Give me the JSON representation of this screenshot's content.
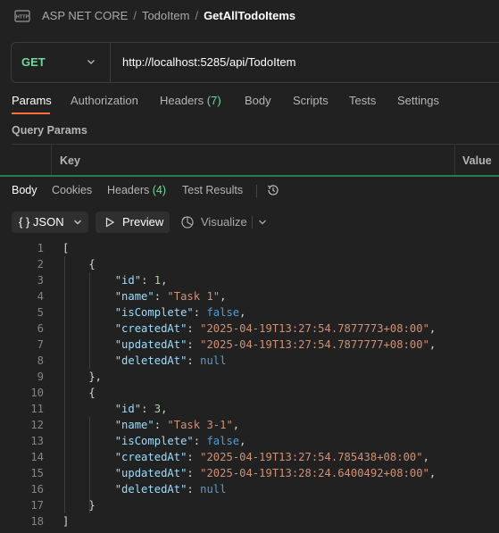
{
  "breadcrumb": {
    "icon": "http-request-icon",
    "items": [
      "ASP NET CORE",
      "TodoItem"
    ],
    "separator": "/",
    "current": "GetAllTodoItems"
  },
  "request": {
    "method": "GET",
    "url": "http://localhost:5285/api/TodoItem"
  },
  "request_tabs": {
    "params": "Params",
    "authorization": "Authorization",
    "headers": "Headers",
    "headers_count": "(7)",
    "body": "Body",
    "scripts": "Scripts",
    "tests": "Tests",
    "settings": "Settings"
  },
  "query_params": {
    "title": "Query Params",
    "key_header": "Key",
    "value_header": "Value"
  },
  "response_tabs": {
    "body": "Body",
    "cookies": "Cookies",
    "headers": "Headers",
    "headers_count": "(4)",
    "test_results": "Test Results"
  },
  "toolbar": {
    "format": "{ } JSON",
    "preview": "Preview",
    "visualize": "Visualize"
  },
  "colors": {
    "accent": "#ff6c37",
    "method": "#6bdd9a",
    "divider": "#247d4b"
  },
  "response_lines": [
    {
      "n": "1",
      "t": [
        [
          "p",
          "["
        ]
      ]
    },
    {
      "n": "2",
      "t": [
        [
          "p",
          "    {"
        ]
      ]
    },
    {
      "n": "3",
      "t": [
        [
          "p",
          "        "
        ],
        [
          "k",
          "\"id\""
        ],
        [
          "p",
          ": "
        ],
        [
          "n",
          "1"
        ],
        [
          "p",
          ","
        ]
      ]
    },
    {
      "n": "4",
      "t": [
        [
          "p",
          "        "
        ],
        [
          "k",
          "\"name\""
        ],
        [
          "p",
          ": "
        ],
        [
          "s",
          "\"Task 1\""
        ],
        [
          "p",
          ","
        ]
      ]
    },
    {
      "n": "5",
      "t": [
        [
          "p",
          "        "
        ],
        [
          "k",
          "\"isComplete\""
        ],
        [
          "p",
          ": "
        ],
        [
          "b",
          "false"
        ],
        [
          "p",
          ","
        ]
      ]
    },
    {
      "n": "6",
      "t": [
        [
          "p",
          "        "
        ],
        [
          "k",
          "\"createdAt\""
        ],
        [
          "p",
          ": "
        ],
        [
          "s",
          "\"2025-04-19T13:27:54.7877773+08:00\""
        ],
        [
          "p",
          ","
        ]
      ]
    },
    {
      "n": "7",
      "t": [
        [
          "p",
          "        "
        ],
        [
          "k",
          "\"updatedAt\""
        ],
        [
          "p",
          ": "
        ],
        [
          "s",
          "\"2025-04-19T13:27:54.7877777+08:00\""
        ],
        [
          "p",
          ","
        ]
      ]
    },
    {
      "n": "8",
      "t": [
        [
          "p",
          "        "
        ],
        [
          "k",
          "\"deletedAt\""
        ],
        [
          "p",
          ": "
        ],
        [
          "b",
          "null"
        ]
      ]
    },
    {
      "n": "9",
      "t": [
        [
          "p",
          "    },"
        ]
      ]
    },
    {
      "n": "10",
      "t": [
        [
          "p",
          "    {"
        ]
      ]
    },
    {
      "n": "11",
      "t": [
        [
          "p",
          "        "
        ],
        [
          "k",
          "\"id\""
        ],
        [
          "p",
          ": "
        ],
        [
          "n",
          "3"
        ],
        [
          "p",
          ","
        ]
      ]
    },
    {
      "n": "12",
      "t": [
        [
          "p",
          "        "
        ],
        [
          "k",
          "\"name\""
        ],
        [
          "p",
          ": "
        ],
        [
          "s",
          "\"Task 3-1\""
        ],
        [
          "p",
          ","
        ]
      ]
    },
    {
      "n": "13",
      "t": [
        [
          "p",
          "        "
        ],
        [
          "k",
          "\"isComplete\""
        ],
        [
          "p",
          ": "
        ],
        [
          "b",
          "false"
        ],
        [
          "p",
          ","
        ]
      ]
    },
    {
      "n": "14",
      "t": [
        [
          "p",
          "        "
        ],
        [
          "k",
          "\"createdAt\""
        ],
        [
          "p",
          ": "
        ],
        [
          "s",
          "\"2025-04-19T13:27:54.785438+08:00\""
        ],
        [
          "p",
          ","
        ]
      ]
    },
    {
      "n": "15",
      "t": [
        [
          "p",
          "        "
        ],
        [
          "k",
          "\"updatedAt\""
        ],
        [
          "p",
          ": "
        ],
        [
          "s",
          "\"2025-04-19T13:28:24.6400492+08:00\""
        ],
        [
          "p",
          ","
        ]
      ]
    },
    {
      "n": "16",
      "t": [
        [
          "p",
          "        "
        ],
        [
          "k",
          "\"deletedAt\""
        ],
        [
          "p",
          ": "
        ],
        [
          "b",
          "null"
        ]
      ]
    },
    {
      "n": "17",
      "t": [
        [
          "p",
          "    }"
        ]
      ]
    },
    {
      "n": "18",
      "t": [
        [
          "p",
          "]"
        ]
      ]
    }
  ]
}
